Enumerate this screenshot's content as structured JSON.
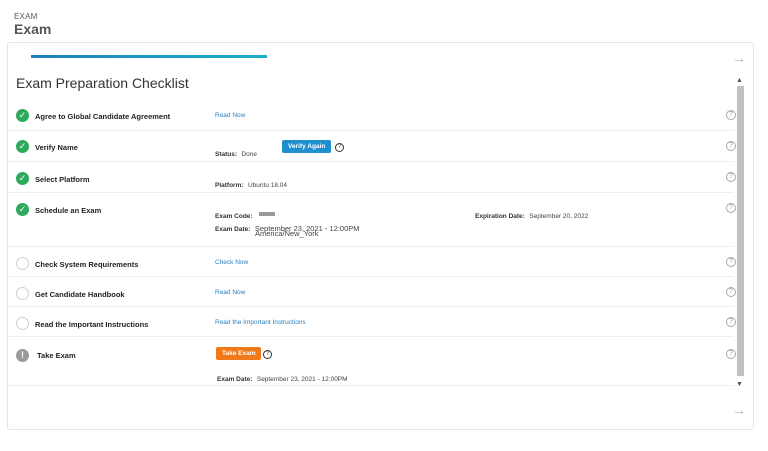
{
  "header": {
    "small_label": "EXAM",
    "title": "Exam"
  },
  "progress": {
    "fraction": 0.3
  },
  "checklist": {
    "title": "Exam Preparation Checklist",
    "items": [
      {
        "label": "Agree to Global Candidate Agreement",
        "status": "done",
        "link": "Read Now"
      },
      {
        "label": "Verify Name",
        "status": "done",
        "status_label": "Status:",
        "status_value": "Done",
        "button": "Verify Again"
      },
      {
        "label": "Select Platform",
        "status": "done",
        "platform_label": "Platform:",
        "platform_value": "Ubuntu 18.04"
      },
      {
        "label": "Schedule an Exam",
        "status": "done",
        "exam_code_label": "Exam Code:",
        "exam_date_label": "Exam Date:",
        "exam_date_value": "September 23, 2021 - 12:00PM",
        "timezone": "America/New_York",
        "expiration_label": "Expiration Date:",
        "expiration_value": "September 20, 2022"
      },
      {
        "label": "Check System Requirements",
        "status": "todo",
        "link": "Check Now"
      },
      {
        "label": "Get Candidate Handbook",
        "status": "todo",
        "link": "Read Now"
      },
      {
        "label": "Read the Important Instructions",
        "status": "todo",
        "link": "Read the Important Instructions"
      },
      {
        "label": "Take Exam",
        "status": "warning",
        "button": "Take Exam",
        "exam_date_label": "Exam Date:",
        "exam_date_value": "September 23, 2021 - 12:00PM"
      }
    ]
  },
  "icons": {
    "check": "✓",
    "warning": "!",
    "help": "?",
    "arrow": "→",
    "scroll_up": "▲",
    "scroll_down": "▼"
  },
  "colors": {
    "done": "#2eaa5c",
    "link": "#2a7fc0",
    "primary_button": "#1f8fd0",
    "take_exam_button": "#f07a1a",
    "progress": "#1d7fbf"
  }
}
